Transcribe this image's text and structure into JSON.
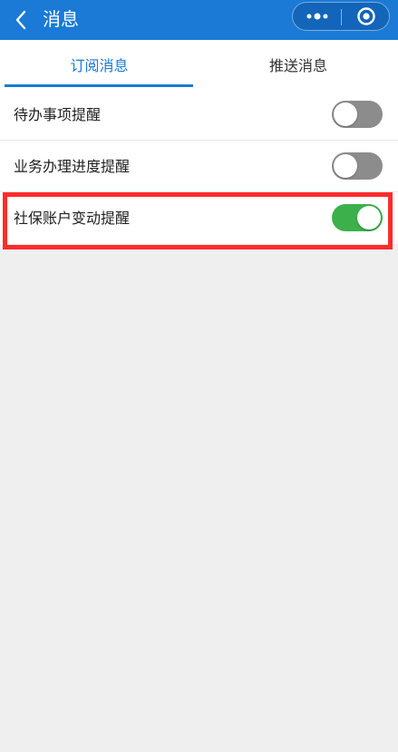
{
  "header": {
    "title": "消息",
    "back_icon": "chevron-left-icon",
    "more_icon": "more-dots-icon",
    "close_icon": "target-circle-icon"
  },
  "tabs": [
    {
      "label": "订阅消息",
      "active": true
    },
    {
      "label": "推送消息",
      "active": false
    }
  ],
  "settings": [
    {
      "label": "待办事项提醒",
      "enabled": false
    },
    {
      "label": "业务办理进度提醒",
      "enabled": false
    },
    {
      "label": "社保账户变动提醒",
      "enabled": true
    }
  ],
  "colors": {
    "primary": "#1a7ad6",
    "switch_on": "#3cb04a",
    "switch_off": "#8c8c8c",
    "highlight": "#ff2b2b",
    "background": "#efefef"
  }
}
